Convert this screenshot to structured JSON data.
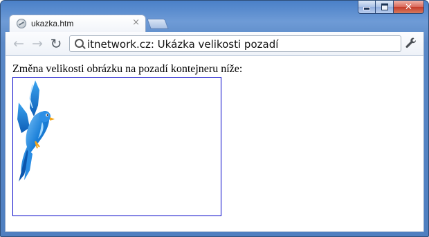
{
  "window": {
    "controls": {
      "minimize_icon": "minimize-icon",
      "maximize_icon": "maximize-icon",
      "close_glyph": "✕"
    }
  },
  "tabs": [
    {
      "title": "ukazka.htm",
      "close_glyph": "×",
      "active": true
    }
  ],
  "toolbar": {
    "back_glyph": "←",
    "forward_glyph": "→",
    "reload_glyph": "↻",
    "address": "itnetwork.cz: Ukázka velikosti pozadí",
    "wrench_glyph": "🔧"
  },
  "page": {
    "text": "Změna velikosti obrázku na pozadí kontejneru níže:",
    "container_border_color": "#0000c8",
    "background_image": "blue-bird-image"
  },
  "colors": {
    "frame": "#5a88c6",
    "close_button": "#c63c2a"
  }
}
